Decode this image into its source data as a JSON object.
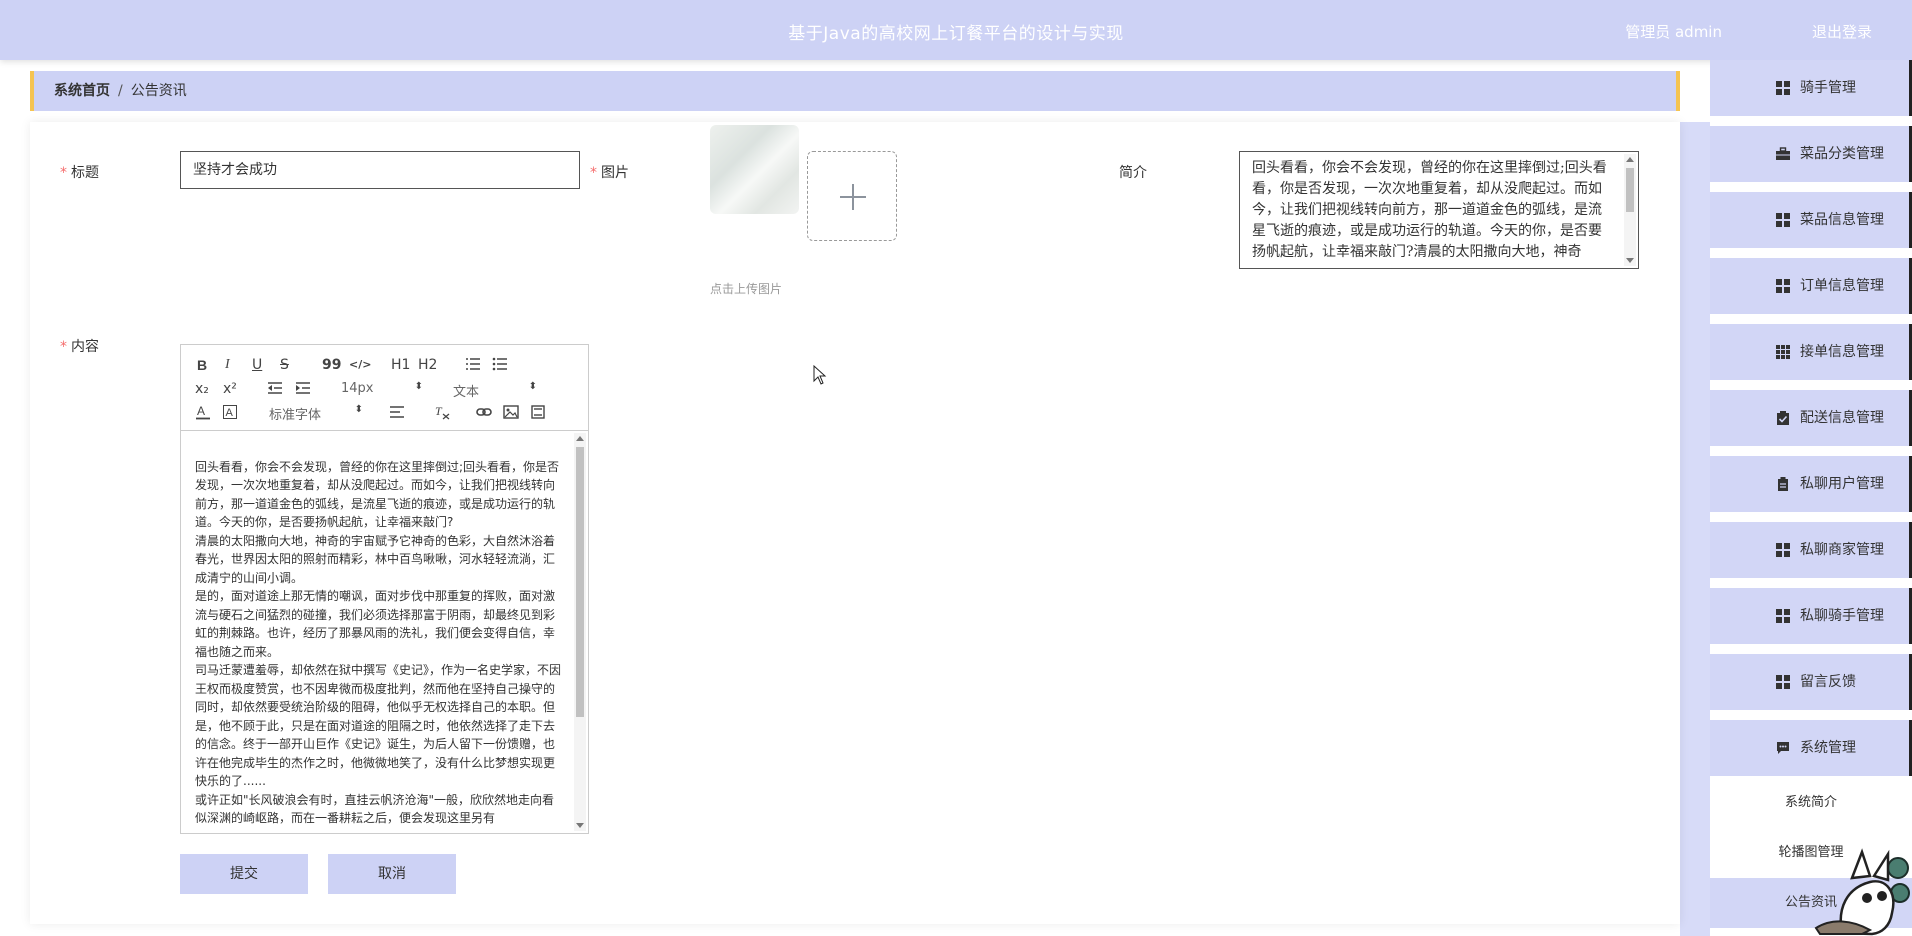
{
  "header": {
    "title": "基于Java的高校网上订餐平台的设计与实现",
    "user": "管理员 admin",
    "logout": "退出登录"
  },
  "breadcrumb": {
    "home": "系统首页",
    "separator": "/",
    "current": "公告资讯"
  },
  "form": {
    "title_label": "标题",
    "title_value": "坚持才会成功",
    "image_label": "图片",
    "upload_hint": "点击上传图片",
    "intro_label": "简介",
    "intro_value": "回头看看，你会不会发现，曾经的你在这里摔倒过;回头看看，你是否发现，一次次地重复着，却从没爬起过。而如今，让我们把视线转向前方，那一道道金色的弧线，是流星飞逝的痕迹，或是成功运行的轨道。今天的你，是否要扬帆起航，让幸福来敲门?清晨的太阳撒向大地，神奇",
    "content_label": "内容",
    "required_mark": "*",
    "submit": "提交",
    "cancel": "取消"
  },
  "editor": {
    "bold": "B",
    "italic": "I",
    "underline": "U",
    "strike": "S",
    "blockquote": "99",
    "code": "</>",
    "h1": "H1",
    "h2": "H2",
    "sub": "x₂",
    "sup": "x²",
    "size": "14px",
    "header_select": "文本",
    "font_select": "标准字体",
    "content": "回头看看，你会不会发现，曾经的你在这里摔倒过;回头看看，你是否发现，一次次地重复着，却从没爬起过。而如今，让我们把视线转向前方，那一道道金色的弧线，是流星飞逝的痕迹，或是成功运行的轨道。今天的你，是否要扬帆起航，让幸福来敲门?\n清晨的太阳撒向大地，神奇的宇宙赋予它神奇的色彩，大自然沐浴着春光，世界因太阳的照射而精彩，林中百鸟啾啾，河水轻轻流淌，汇成清宁的山间小调。\n是的，面对道途上那无情的嘲讽，面对步伐中那重复的挥败，面对激流与硬石之间猛烈的碰撞，我们必须选择那富于阴雨，却最终见到彩虹的荆棘路。也许，经历了那暴风雨的洗礼，我们便会变得自信，幸福也随之而来。\n司马迁蒙遭羞辱，却依然在狱中撰写《史记》，作为一名史学家，不因王权而极度赞赏，也不因卑微而极度批判，然而他在坚持自己操守的同时，却依然要受统治阶级的阻碍，他似乎无权选择自己的本职。但是，他不顾于此，只是在面对道途的阻隔之时，他依然选择了走下去的信念。终于一部开山巨作《史记》诞生，为后人留下一份馈赠，也许在他完成毕生的杰作之时，他微微地笑了，没有什么比梦想实现更快乐的了......\n或许正如\"长风破浪会有时，直挂云帆济沧海\"一般，欣欣然地走向看似深渊的崎岖路，而在一番耕耘之后，便会发现这里另有"
  },
  "sidebar": {
    "items": [
      {
        "label": "骑手管理",
        "icon": "grid-icon"
      },
      {
        "label": "菜品分类管理",
        "icon": "briefcase-icon"
      },
      {
        "label": "菜品信息管理",
        "icon": "grid-icon"
      },
      {
        "label": "订单信息管理",
        "icon": "grid-icon"
      },
      {
        "label": "接单信息管理",
        "icon": "grid9-icon"
      },
      {
        "label": "配送信息管理",
        "icon": "clipboard-check-icon"
      },
      {
        "label": "私聊用户管理",
        "icon": "clipboard-icon"
      },
      {
        "label": "私聊商家管理",
        "icon": "grid-icon"
      },
      {
        "label": "私聊骑手管理",
        "icon": "grid-icon"
      },
      {
        "label": "留言反馈",
        "icon": "grid-icon"
      },
      {
        "label": "系统管理",
        "icon": "chat-icon"
      }
    ],
    "subitems": [
      {
        "label": "系统简介"
      },
      {
        "label": "轮播图管理"
      },
      {
        "label": "公告资讯"
      }
    ]
  },
  "colors": {
    "accent": "#cdd2f5",
    "required": "#f56c6c",
    "crumb_border": "#f5c451"
  }
}
